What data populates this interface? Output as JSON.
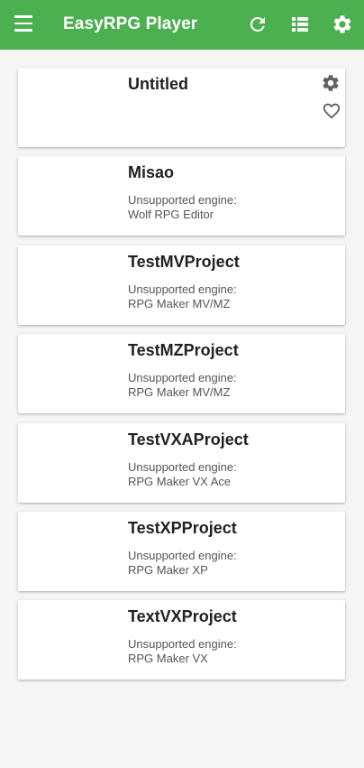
{
  "appbar": {
    "title": "EasyRPG Player",
    "color": "#4caf50",
    "icons": [
      "menu-icon",
      "refresh-icon",
      "list-view-icon",
      "settings-gear-icon"
    ]
  },
  "games": [
    {
      "name": "Untitled",
      "engine_label": "",
      "engine": "",
      "icons": [
        "settings-gear-icon",
        "heart-outline-icon"
      ]
    },
    {
      "name": "Misao",
      "engine_label": "Unsupported engine:",
      "engine": "Wolf RPG Editor"
    },
    {
      "name": "TestMVProject",
      "engine_label": "Unsupported engine:",
      "engine": "RPG Maker MV/MZ"
    },
    {
      "name": "TestMZProject",
      "engine_label": "Unsupported engine:",
      "engine": "RPG Maker MV/MZ"
    },
    {
      "name": "TestVXAProject",
      "engine_label": "Unsupported engine:",
      "engine": "RPG Maker VX Ace"
    },
    {
      "name": "TestXPProject",
      "engine_label": "Unsupported engine:",
      "engine": "RPG Maker XP"
    },
    {
      "name": "TextVXProject",
      "engine_label": "Unsupported engine:",
      "engine": "RPG Maker VX"
    }
  ]
}
